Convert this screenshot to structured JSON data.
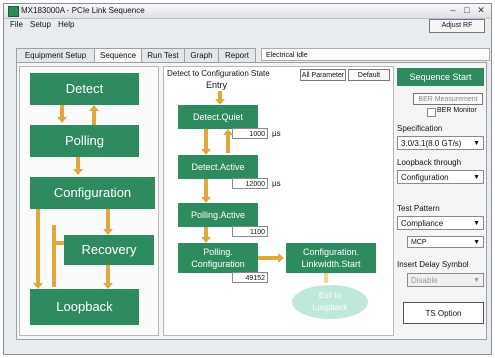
{
  "window": {
    "title": "MX183000A - PCIe Link Sequence",
    "min_glyph": "–",
    "max_glyph": "□",
    "close_glyph": "✕"
  },
  "menu": [
    "File",
    "Setup",
    "Help"
  ],
  "adjust_button": "Adjust RF",
  "tabs": [
    "Equipment Setup",
    "Sequence",
    "Run Test",
    "Graph",
    "Report"
  ],
  "active_tab": "Sequence",
  "status_text": "Electrical Idle",
  "left_states": {
    "detect": "Detect",
    "polling": "Polling",
    "configuration": "Configuration",
    "recovery": "Recovery",
    "loopback": "Loopback"
  },
  "middle": {
    "title": "Detect to Configuration State",
    "all_parameter_button": "All Parameter",
    "default_button": "Default",
    "entry_label": "Entry",
    "detect_quiet": "Detect.Quiet",
    "detect_quiet_value": "1000",
    "detect_active": "Detect.Active",
    "detect_active_value": "12000",
    "polling_active": "Polling.Active",
    "polling_active_value": "1100",
    "polling_configuration_line1": "Polling.",
    "polling_configuration_line2": "Configuration",
    "polling_configuration_value": "49152",
    "config_linkwidth_line1": "Configuration.",
    "config_linkwidth_line2": "Linkwidth.Start",
    "exit_line1": "Exit to",
    "exit_line2": "Loopback",
    "unit": "µs"
  },
  "right": {
    "sequence_start": "Sequence Start",
    "ber_measurement": "BER Measurement",
    "ber_monitor": "BER Monitor",
    "specification_label": "Specification",
    "specification_value": "3.0/3.1(8.0 GT/s)",
    "loopback_label": "Loopback through",
    "loopback_value": "Configuration",
    "test_pattern_label": "Test Pattern",
    "test_pattern_value": "Compliance",
    "pattern_sub_value": "MCP",
    "insert_delay_label": "Insert Delay Symbol",
    "insert_delay_value": "Disable",
    "ts_option": "TS Option"
  },
  "colors": {
    "state_green": "#2e8b5e",
    "accent_green": "#2e8b5e",
    "arrow_orange": "#e2a73a",
    "exit_light": "#bfe8d8"
  }
}
